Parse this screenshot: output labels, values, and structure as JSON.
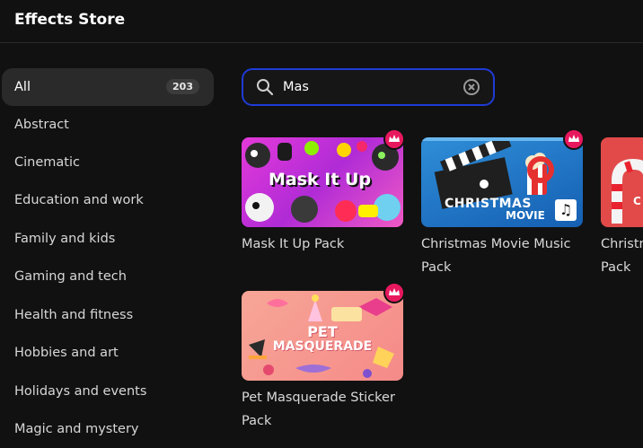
{
  "header": {
    "title": "Effects Store"
  },
  "sidebar": {
    "items": [
      {
        "label": "All",
        "count": "203"
      },
      {
        "label": "Abstract"
      },
      {
        "label": "Cinematic"
      },
      {
        "label": "Education and work"
      },
      {
        "label": "Family and kids"
      },
      {
        "label": "Gaming and tech"
      },
      {
        "label": "Health and fitness"
      },
      {
        "label": "Hobbies and art"
      },
      {
        "label": "Holidays and events"
      },
      {
        "label": "Magic and mystery"
      }
    ]
  },
  "search": {
    "value": "Mas"
  },
  "cards": [
    {
      "title": "Mask It Up Pack",
      "thumb_text": "Mask It Up"
    },
    {
      "title": "Christmas Movie Music Pack",
      "thumb_text_1": "CHRISTMAS",
      "thumb_text_2": "MOVIE"
    },
    {
      "title": "Christm Pack",
      "thumb_text": "C"
    },
    {
      "title": "Pet Masquerade Sticker Pack",
      "thumb_text_1": "PET",
      "thumb_text_2": "MASQUERADE"
    }
  ],
  "colors": {
    "accent": "#1f3bd6",
    "premium": "#e8185e",
    "background": "#111111"
  }
}
